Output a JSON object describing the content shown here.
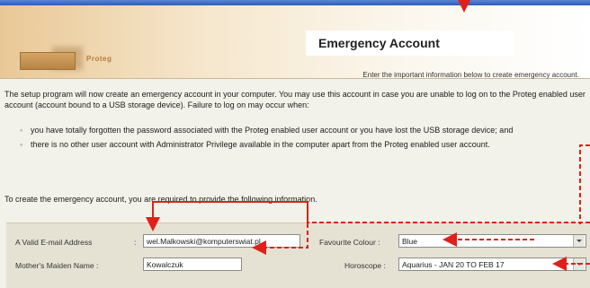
{
  "header": {
    "brand": "Proteg",
    "title": "Emergency Account",
    "subtitle": "Enter the important information below to create emergency account."
  },
  "body": {
    "intro": "The setup program will now create an emergency account in your computer. You may use this account in case you are unable to log on to the Proteg enabled user account (account bound to a USB storage device). Failure to log on may occur when:",
    "bullets": [
      "you have totally forgotten the password associated with the Proteg enabled user account or you have lost the USB storage device; and",
      "there is no other user account with Administrator Privilege available in the computer apart from the Proteg enabled user account."
    ],
    "prompt": "To create the emergency account, you are required to provide the following information."
  },
  "form": {
    "email_label": "A Valid E-mail Address",
    "email_value": "wel.Malkowski@komputerswiat.pl",
    "maiden_label": "Mother's Maiden Name :",
    "maiden_value": "Kowalczuk",
    "colour_label": "Favourite Colour :",
    "colour_value": "Blue",
    "horoscope_label": "Horoscope :",
    "horoscope_value": "Aquarius - JAN 20 TO FEB 17"
  },
  "colors": {
    "annotation": "#e0201a",
    "header_top": "#2c5bb8"
  }
}
